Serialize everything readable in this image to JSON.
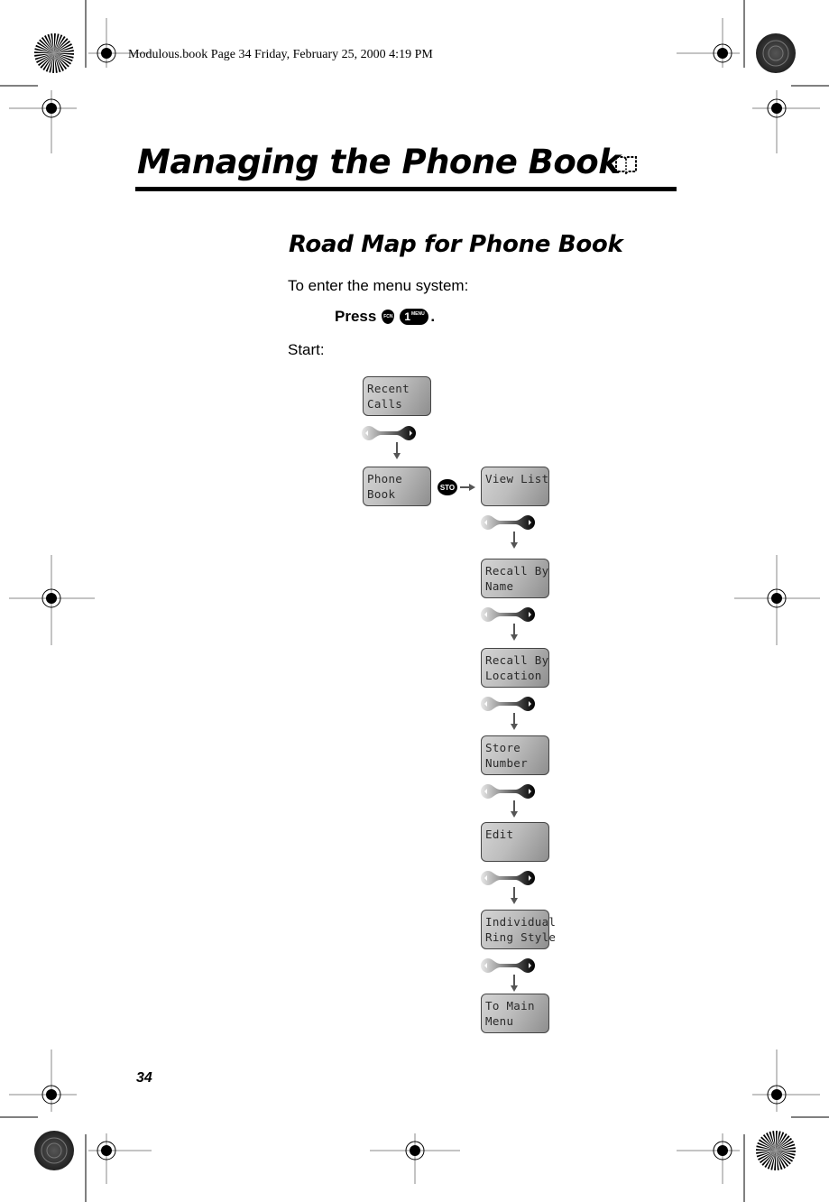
{
  "print_header": "Modulous.book  Page 34  Friday, February 25, 2000  4:19 PM",
  "chapter": {
    "title": "Managing the Phone Book",
    "icon": "phone-book-icon"
  },
  "section": {
    "title": "Road Map for Phone Book",
    "intro": "To enter the menu system:",
    "press_label": "Press",
    "keys": [
      {
        "name": "fcn-key",
        "label": "FCN"
      },
      {
        "name": "menu-key",
        "label": "1",
        "sublabel": "MENU"
      }
    ],
    "press_suffix": ".",
    "start_label": "Start:"
  },
  "road_map": {
    "start_screens": [
      {
        "line1": "Recent",
        "line2": "Calls"
      },
      {
        "line1": "Phone",
        "line2": "Book"
      }
    ],
    "select_key": {
      "label": "STO",
      "icon": "sto-key-icon"
    },
    "scroll_icon": "scroll-key-icon",
    "arrow_icon": "down-arrow-icon",
    "submenu_screens": [
      {
        "line1": "View List",
        "line2": ""
      },
      {
        "line1": "Recall By",
        "line2": "Name"
      },
      {
        "line1": "Recall By",
        "line2": "Location"
      },
      {
        "line1": "Store",
        "line2": "Number"
      },
      {
        "line1": "Edit",
        "line2": ""
      },
      {
        "line1": "Individual",
        "line2": "Ring Style"
      },
      {
        "line1": "To Main",
        "line2": "Menu"
      }
    ]
  },
  "page_number": "34"
}
